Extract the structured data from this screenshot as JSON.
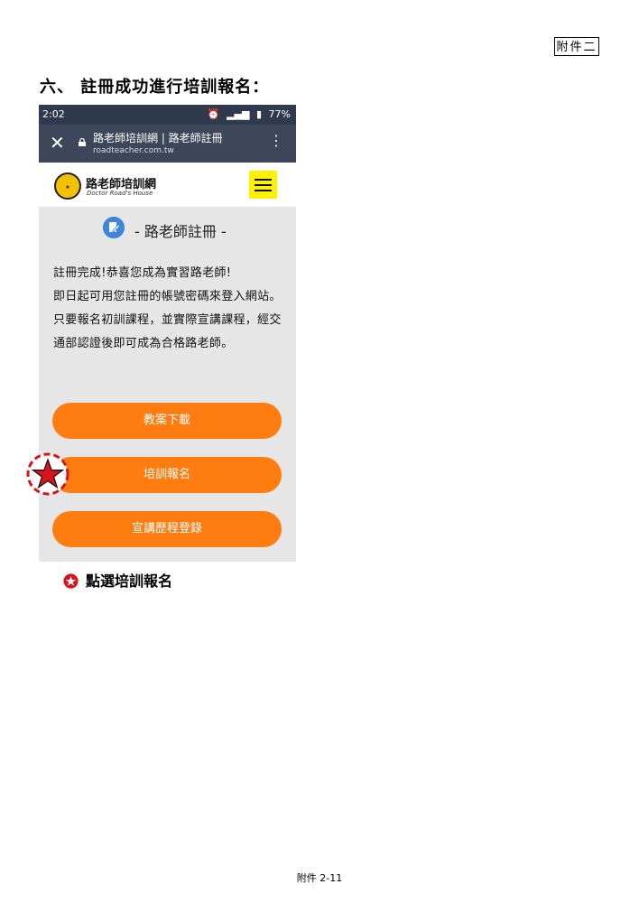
{
  "document": {
    "annex_label": "附件二",
    "heading": "六、 註冊成功進行培訓報名：",
    "note": "點選培訓報名",
    "footer": "附件 2-11"
  },
  "phone": {
    "status": {
      "time": "2:02",
      "battery": "77%"
    },
    "browser": {
      "page_title": "路老師培訓網 | 路老師註冊",
      "url": "roadteacher.com.tw"
    },
    "site": {
      "name": "路老師培訓網",
      "subtitle": "Doctor Road's House"
    },
    "registration": {
      "title": "- 路老師註冊 -",
      "message": "註冊完成!恭喜您成為實習路老師!\n即日起可用您註冊的帳號密碼來登入網站。只要報名初訓課程，並實際宣講課程，經交通部認證後即可成為合格路老師。"
    },
    "buttons": {
      "lesson_download": "教案下載",
      "training_signup": "培訓報名",
      "lecture_log": "宣講歷程登錄"
    }
  },
  "colors": {
    "button_orange": "#ff7c10",
    "status_bar": "#2f3a4d",
    "marker_red": "#d8131b",
    "menu_yellow": "#fff200"
  }
}
